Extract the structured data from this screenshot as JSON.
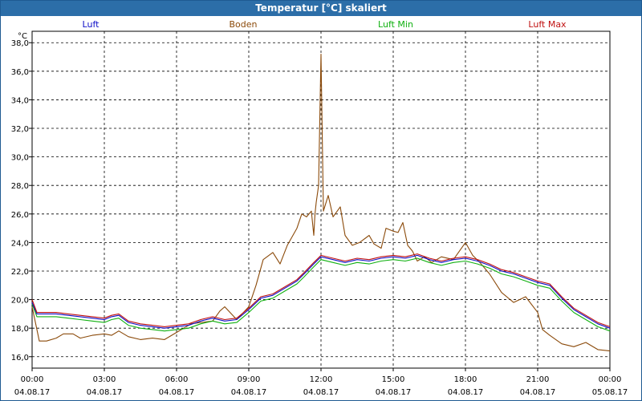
{
  "window": {
    "title": "Temperatur [°C] skaliert"
  },
  "colors": {
    "titlebar": "#2c6ea8",
    "grid": "#000000"
  },
  "chart_data": {
    "type": "line",
    "title": "Temperatur [°C] skaliert",
    "ylabel": "°C",
    "xlabel": "",
    "xlim": [
      0,
      24
    ],
    "ylim": [
      15.2,
      38.8
    ],
    "grid": true,
    "legend_position": "top",
    "y_ticks": [
      "16,0",
      "18,0",
      "20,0",
      "22,0",
      "24,0",
      "26,0",
      "28,0",
      "30,0",
      "32,0",
      "34,0",
      "36,0",
      "38,0"
    ],
    "x_ticks": [
      {
        "time": "00:00",
        "date": "04.08.17"
      },
      {
        "time": "03:00",
        "date": "04.08.17"
      },
      {
        "time": "06:00",
        "date": "04.08.17"
      },
      {
        "time": "09:00",
        "date": "04.08.17"
      },
      {
        "time": "12:00",
        "date": "04.08.17"
      },
      {
        "time": "15:00",
        "date": "04.08.17"
      },
      {
        "time": "18:00",
        "date": "04.08.17"
      },
      {
        "time": "21:00",
        "date": "04.08.17"
      },
      {
        "time": "00:00",
        "date": "05.08.17"
      }
    ],
    "series": [
      {
        "name": "Luft",
        "color": "#1010c8",
        "x": [
          0,
          0.2,
          0.5,
          1,
          1.5,
          2,
          2.5,
          3,
          3.3,
          3.6,
          4,
          4.5,
          5,
          5.5,
          6,
          6.5,
          7,
          7.5,
          8,
          8.5,
          9,
          9.5,
          10,
          10.5,
          11,
          11.3,
          11.7,
          12,
          12.5,
          13,
          13.5,
          14,
          14.5,
          15,
          15.5,
          16,
          16.5,
          17,
          17.5,
          18,
          18.5,
          19,
          19.5,
          20,
          20.5,
          21,
          21.5,
          22,
          22.5,
          23,
          23.5,
          24
        ],
        "y": [
          19.8,
          19.0,
          19.0,
          19.0,
          18.9,
          18.8,
          18.7,
          18.6,
          18.8,
          18.9,
          18.4,
          18.2,
          18.1,
          18.0,
          18.1,
          18.2,
          18.5,
          18.7,
          18.5,
          18.6,
          19.3,
          20.1,
          20.3,
          20.8,
          21.3,
          21.8,
          22.5,
          23.0,
          22.8,
          22.6,
          22.8,
          22.7,
          22.9,
          23.0,
          22.9,
          23.1,
          22.8,
          22.6,
          22.8,
          22.9,
          22.7,
          22.4,
          22.0,
          21.8,
          21.5,
          21.2,
          21.0,
          20.1,
          19.3,
          18.8,
          18.3,
          18.0
        ]
      },
      {
        "name": "Boden",
        "color": "#8b4a0a",
        "x": [
          0,
          0.3,
          0.6,
          1,
          1.3,
          1.7,
          2,
          2.5,
          3,
          3.3,
          3.6,
          4,
          4.5,
          5,
          5.5,
          6,
          6.3,
          6.6,
          7,
          7.5,
          7.8,
          8,
          8.5,
          9,
          9.3,
          9.6,
          10,
          10.3,
          10.6,
          11,
          11.2,
          11.4,
          11.6,
          11.7,
          11.75,
          11.8,
          11.9,
          12,
          12.1,
          12.3,
          12.5,
          12.8,
          13,
          13.3,
          13.6,
          14,
          14.2,
          14.5,
          14.7,
          15,
          15.2,
          15.4,
          15.6,
          15.8,
          16,
          16.3,
          16.6,
          17,
          17.5,
          18,
          18.3,
          18.6,
          19,
          19.5,
          20,
          20.5,
          21,
          21.2,
          21.5,
          22,
          22.5,
          23,
          23.5,
          24
        ],
        "y": [
          19.5,
          17.1,
          17.1,
          17.3,
          17.6,
          17.6,
          17.3,
          17.5,
          17.6,
          17.5,
          17.8,
          17.4,
          17.2,
          17.3,
          17.2,
          17.7,
          18.0,
          18.3,
          18.4,
          18.5,
          19.2,
          19.5,
          18.6,
          19.5,
          21.0,
          22.8,
          23.3,
          22.5,
          23.8,
          25.0,
          26.0,
          25.8,
          26.2,
          24.5,
          26.0,
          26.8,
          28.0,
          37.2,
          26.2,
          27.3,
          25.8,
          26.5,
          24.5,
          23.8,
          24.0,
          24.5,
          23.9,
          23.6,
          25.0,
          24.8,
          24.7,
          25.4,
          23.8,
          23.4,
          22.7,
          23.0,
          22.6,
          23.0,
          22.8,
          24.0,
          23.1,
          22.6,
          21.8,
          20.5,
          19.8,
          20.2,
          19.1,
          17.9,
          17.5,
          16.9,
          16.7,
          17.0,
          16.5,
          16.4
        ]
      },
      {
        "name": "Luft Min",
        "color": "#10b010",
        "x": [
          0,
          0.2,
          0.5,
          1,
          1.5,
          2,
          2.5,
          3,
          3.3,
          3.6,
          4,
          4.5,
          5,
          5.5,
          6,
          6.5,
          7,
          7.5,
          8,
          8.5,
          9,
          9.5,
          10,
          10.5,
          11,
          11.3,
          11.7,
          12,
          12.5,
          13,
          13.5,
          14,
          14.5,
          15,
          15.5,
          16,
          16.5,
          17,
          17.5,
          18,
          18.5,
          19,
          19.5,
          20,
          20.5,
          21,
          21.5,
          22,
          22.5,
          23,
          23.5,
          24
        ],
        "y": [
          19.7,
          18.8,
          18.8,
          18.8,
          18.7,
          18.6,
          18.5,
          18.4,
          18.6,
          18.7,
          18.2,
          18.0,
          17.9,
          17.8,
          17.9,
          18.0,
          18.3,
          18.5,
          18.3,
          18.4,
          19.1,
          19.9,
          20.1,
          20.6,
          21.1,
          21.6,
          22.3,
          22.8,
          22.6,
          22.4,
          22.6,
          22.5,
          22.7,
          22.8,
          22.7,
          22.9,
          22.6,
          22.4,
          22.6,
          22.7,
          22.5,
          22.2,
          21.8,
          21.6,
          21.3,
          21.0,
          20.8,
          19.9,
          19.1,
          18.6,
          18.1,
          17.8
        ]
      },
      {
        "name": "Luft Max",
        "color": "#c01010",
        "x": [
          0,
          0.2,
          0.5,
          1,
          1.5,
          2,
          2.5,
          3,
          3.3,
          3.6,
          4,
          4.5,
          5,
          5.5,
          6,
          6.5,
          7,
          7.5,
          8,
          8.5,
          9,
          9.5,
          10,
          10.5,
          11,
          11.3,
          11.7,
          12,
          12.5,
          13,
          13.5,
          14,
          14.5,
          15,
          15.5,
          16,
          16.5,
          17,
          17.5,
          18,
          18.5,
          19,
          19.5,
          20,
          20.5,
          21,
          21.5,
          22,
          22.5,
          23,
          23.5,
          24
        ],
        "y": [
          20.0,
          19.1,
          19.1,
          19.1,
          19.0,
          18.9,
          18.8,
          18.7,
          18.9,
          19.0,
          18.5,
          18.3,
          18.2,
          18.1,
          18.2,
          18.3,
          18.6,
          18.8,
          18.6,
          18.7,
          19.4,
          20.2,
          20.4,
          20.9,
          21.4,
          21.9,
          22.6,
          23.1,
          22.9,
          22.7,
          22.9,
          22.8,
          23.0,
          23.1,
          23.0,
          23.2,
          22.9,
          22.7,
          22.9,
          23.0,
          22.8,
          22.5,
          22.1,
          21.9,
          21.6,
          21.3,
          21.1,
          20.2,
          19.4,
          18.9,
          18.4,
          18.1
        ]
      }
    ]
  }
}
